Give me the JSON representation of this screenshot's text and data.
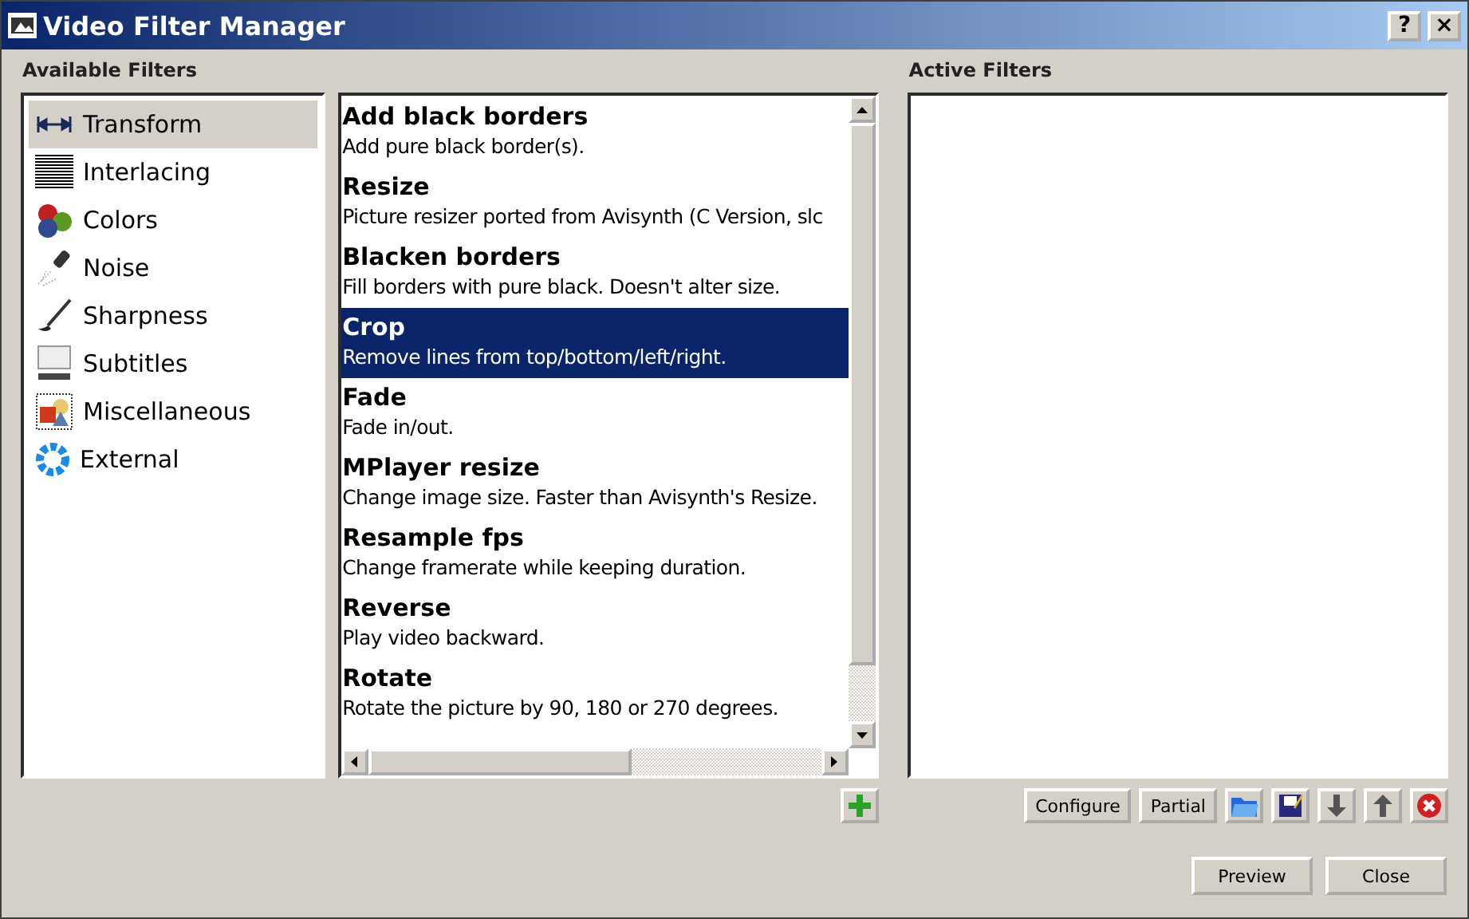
{
  "window": {
    "title": "Video Filter Manager",
    "help": "?",
    "close": "×"
  },
  "available": {
    "label": "Available Filters",
    "categories": [
      {
        "name": "Transform",
        "selected": true
      },
      {
        "name": "Interlacing",
        "selected": false
      },
      {
        "name": "Colors",
        "selected": false
      },
      {
        "name": "Noise",
        "selected": false
      },
      {
        "name": "Sharpness",
        "selected": false
      },
      {
        "name": "Subtitles",
        "selected": false
      },
      {
        "name": "Miscellaneous",
        "selected": false
      },
      {
        "name": "External",
        "selected": false
      }
    ]
  },
  "filters": [
    {
      "name": "Add black borders",
      "description": "Add pure black border(s).",
      "selected": false
    },
    {
      "name": "Resize",
      "description": "Picture resizer ported from Avisynth (C Version, slc",
      "selected": false
    },
    {
      "name": "Blacken borders",
      "description": "Fill borders with pure black. Doesn't alter size.",
      "selected": false
    },
    {
      "name": "Crop",
      "description": "Remove lines from top/bottom/left/right.",
      "selected": true
    },
    {
      "name": "Fade",
      "description": "Fade in/out.",
      "selected": false
    },
    {
      "name": "MPlayer resize",
      "description": "Change image size. Faster than Avisynth's Resize.",
      "selected": false
    },
    {
      "name": "Resample fps",
      "description": "Change framerate while keeping duration.",
      "selected": false
    },
    {
      "name": "Reverse",
      "description": "Play video backward.",
      "selected": false
    },
    {
      "name": "Rotate",
      "description": "Rotate the picture by 90, 180 or 270 degrees.",
      "selected": false
    }
  ],
  "active": {
    "label": "Active Filters"
  },
  "buttons": [
    "Configure",
    "Partial"
  ],
  "footer": [
    "Preview",
    "Close"
  ]
}
